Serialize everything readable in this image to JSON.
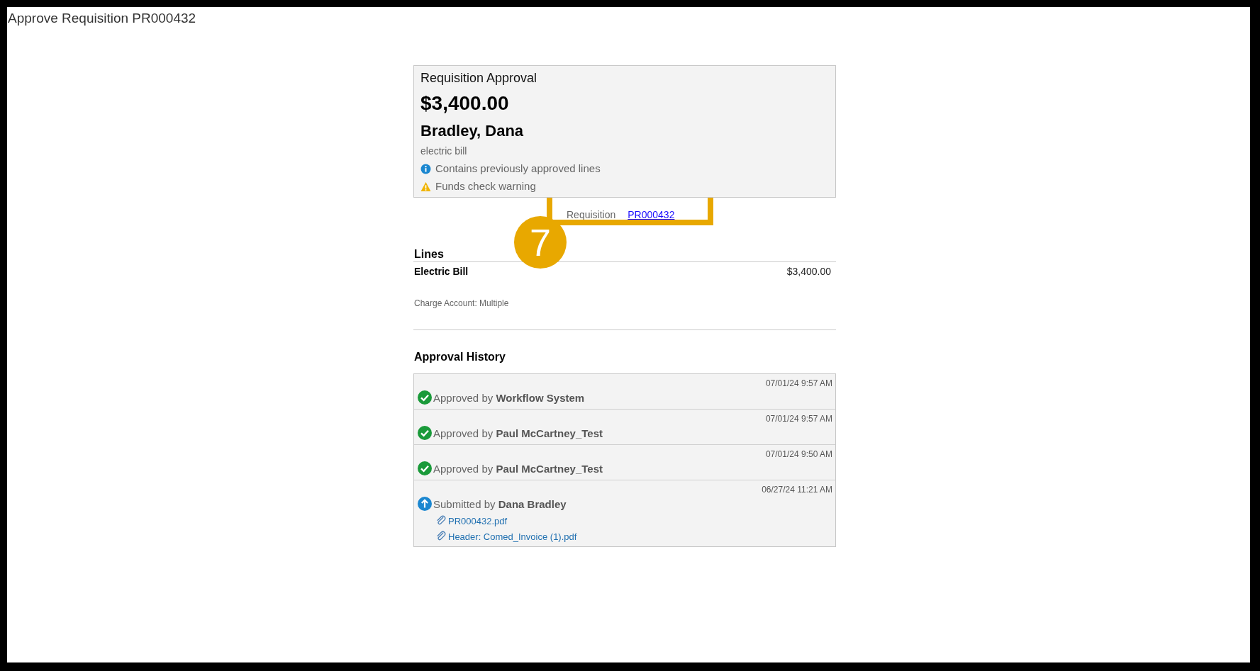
{
  "page_title": "Approve Requisition PR000432",
  "summary": {
    "heading": "Requisition Approval",
    "amount": "$3,400.00",
    "requester": "Bradley, Dana",
    "description": "electric bill",
    "notices": [
      {
        "kind": "info",
        "text": "Contains previously approved lines"
      },
      {
        "kind": "warning",
        "text": "Funds check warning"
      }
    ]
  },
  "requisition": {
    "label": "Requisition",
    "link": "PR000432"
  },
  "callout": {
    "number": "7"
  },
  "lines": {
    "heading": "Lines",
    "items": [
      {
        "name": "Electric Bill",
        "amount": "$3,400.00",
        "charge_account": "Charge Account: Multiple"
      }
    ]
  },
  "approval_history": {
    "heading": "Approval History",
    "entries": [
      {
        "kind": "approved",
        "time": "07/01/24 9:57 AM",
        "action": "Approved by",
        "actor": "Workflow System"
      },
      {
        "kind": "approved",
        "time": "07/01/24 9:57 AM",
        "action": "Approved by",
        "actor": "Paul McCartney_Test"
      },
      {
        "kind": "approved",
        "time": "07/01/24 9:50 AM",
        "action": "Approved by",
        "actor": "Paul McCartney_Test"
      },
      {
        "kind": "submitted",
        "time": "06/27/24 11:21 AM",
        "action": "Submitted by",
        "actor": "Dana Bradley",
        "attachments": [
          "PR000432.pdf",
          "Header: Comed_Invoice (1).pdf"
        ]
      }
    ]
  }
}
